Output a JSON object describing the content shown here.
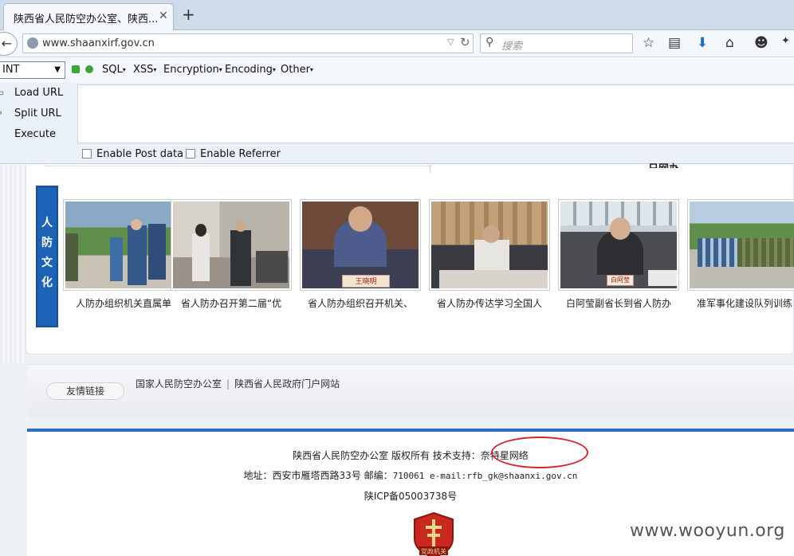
{
  "browser": {
    "tab_title": "陕西省人民防空办公室、陕西...",
    "tab_close_glyph": "✕",
    "new_tab_glyph": "+",
    "back_glyph": "←",
    "url": "www.shaanxirf.gov.cn",
    "search_placeholder": "搜索",
    "icons": [
      "star-icon",
      "reading-list-icon",
      "download-icon",
      "home-icon",
      "chat-icon",
      "menu-icon"
    ]
  },
  "hackbar": {
    "select_value": "INT",
    "menus": [
      "SQL",
      "XSS",
      "Encryption",
      "Encoding",
      "Other"
    ],
    "actions": [
      "Load URL",
      "Split URL",
      "Execute"
    ],
    "checkboxes": [
      "Enable Post data",
      "Enable Referrer"
    ]
  },
  "page": {
    "top_clip_text": "日网办",
    "culture_label": [
      "人",
      "防",
      "文",
      "化"
    ],
    "photos": [
      {
        "caption": "人防办组织机关直属单"
      },
      {
        "caption": "省人防办召开第二届“优"
      },
      {
        "caption": "省人防办组织召开机关、"
      },
      {
        "caption": "省人防办传达学习全国人"
      },
      {
        "caption": "白阿莹副省长到省人防办"
      },
      {
        "caption": "准军事化建设队列训练"
      }
    ],
    "photo_nameplates": [
      "王晓明",
      "白阿莹"
    ],
    "links_label": "友情链接",
    "links": [
      "国家人民防空办公室",
      "陕西省人民政府门户网站"
    ],
    "footer": {
      "copyright": "陕西省人民防空办公室 版权所有 技术支持：奈特星网络",
      "address_prefix": "地址：西安市雁塔西路33号 邮编：",
      "address_mono": "710061 e-mail:rfb_gk@shaanxi.gov.cn",
      "icp": "陕ICP备05003738号",
      "badge_text": "党政机关"
    }
  },
  "watermark": "www.wooyun.org",
  "colors": {
    "accent_blue": "#2a6dc0",
    "label_blue": "#1c63b8",
    "highlight_red": "#d9232d"
  }
}
